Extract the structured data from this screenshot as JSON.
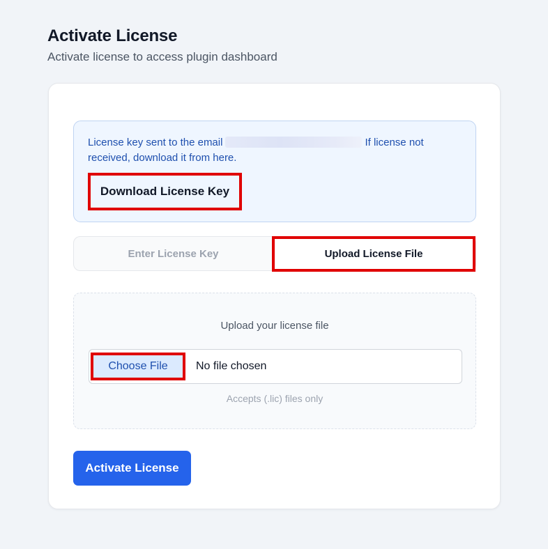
{
  "header": {
    "title": "Activate License",
    "subtitle": "Activate license to access plugin dashboard"
  },
  "info_box": {
    "text_before_email": "License key sent to the email",
    "text_after_email": "If license not received, download it from here.",
    "download_button_label": "Download License Key"
  },
  "tabs": [
    {
      "label": "Enter License Key",
      "active": false
    },
    {
      "label": "Upload License File",
      "active": true
    }
  ],
  "upload": {
    "prompt": "Upload your license file",
    "choose_button_label": "Choose File",
    "file_status": "No file chosen",
    "accepts_hint": "Accepts (.lic) files only"
  },
  "actions": {
    "activate_label": "Activate License"
  },
  "colors": {
    "primary": "#2563eb",
    "highlight_outline": "#e00000",
    "info_text": "#1e4fae"
  }
}
